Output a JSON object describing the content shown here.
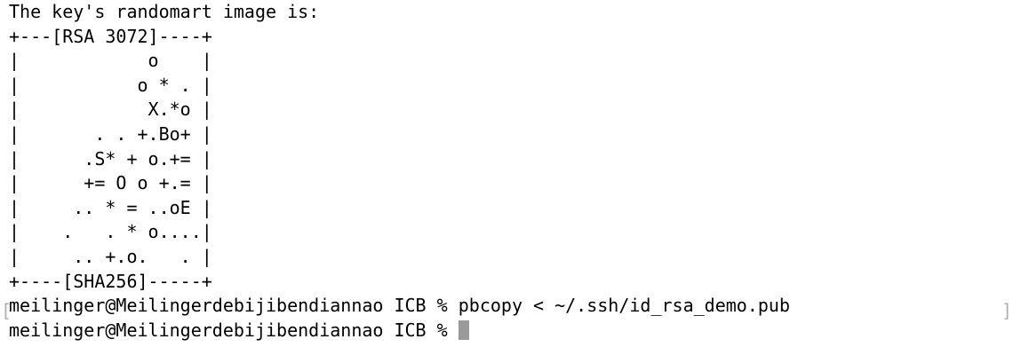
{
  "terminal": {
    "lines": [
      "The key's randomart image is:",
      "+---[RSA 3072]----+",
      "|            o    |",
      "|           o * . |",
      "|            X.*o |",
      "|       . . +.Bo+ |",
      "|      .S* + o.+= |",
      "|      += O o +.= |",
      "|     .. * = ..oE |",
      "|    .   . * o....|",
      "|     .. +.o.   . |",
      "+----[SHA256]-----+"
    ],
    "command_line": {
      "prompt": "meilinger@Meilingerdebijibendiannao ICB % ",
      "command": "pbcopy < ~/.ssh/id_rsa_demo.pub"
    },
    "current_line": {
      "prompt": "meilinger@Meilingerdebijibendiannao ICB % "
    },
    "mark_left": "[",
    "mark_right": "]"
  }
}
